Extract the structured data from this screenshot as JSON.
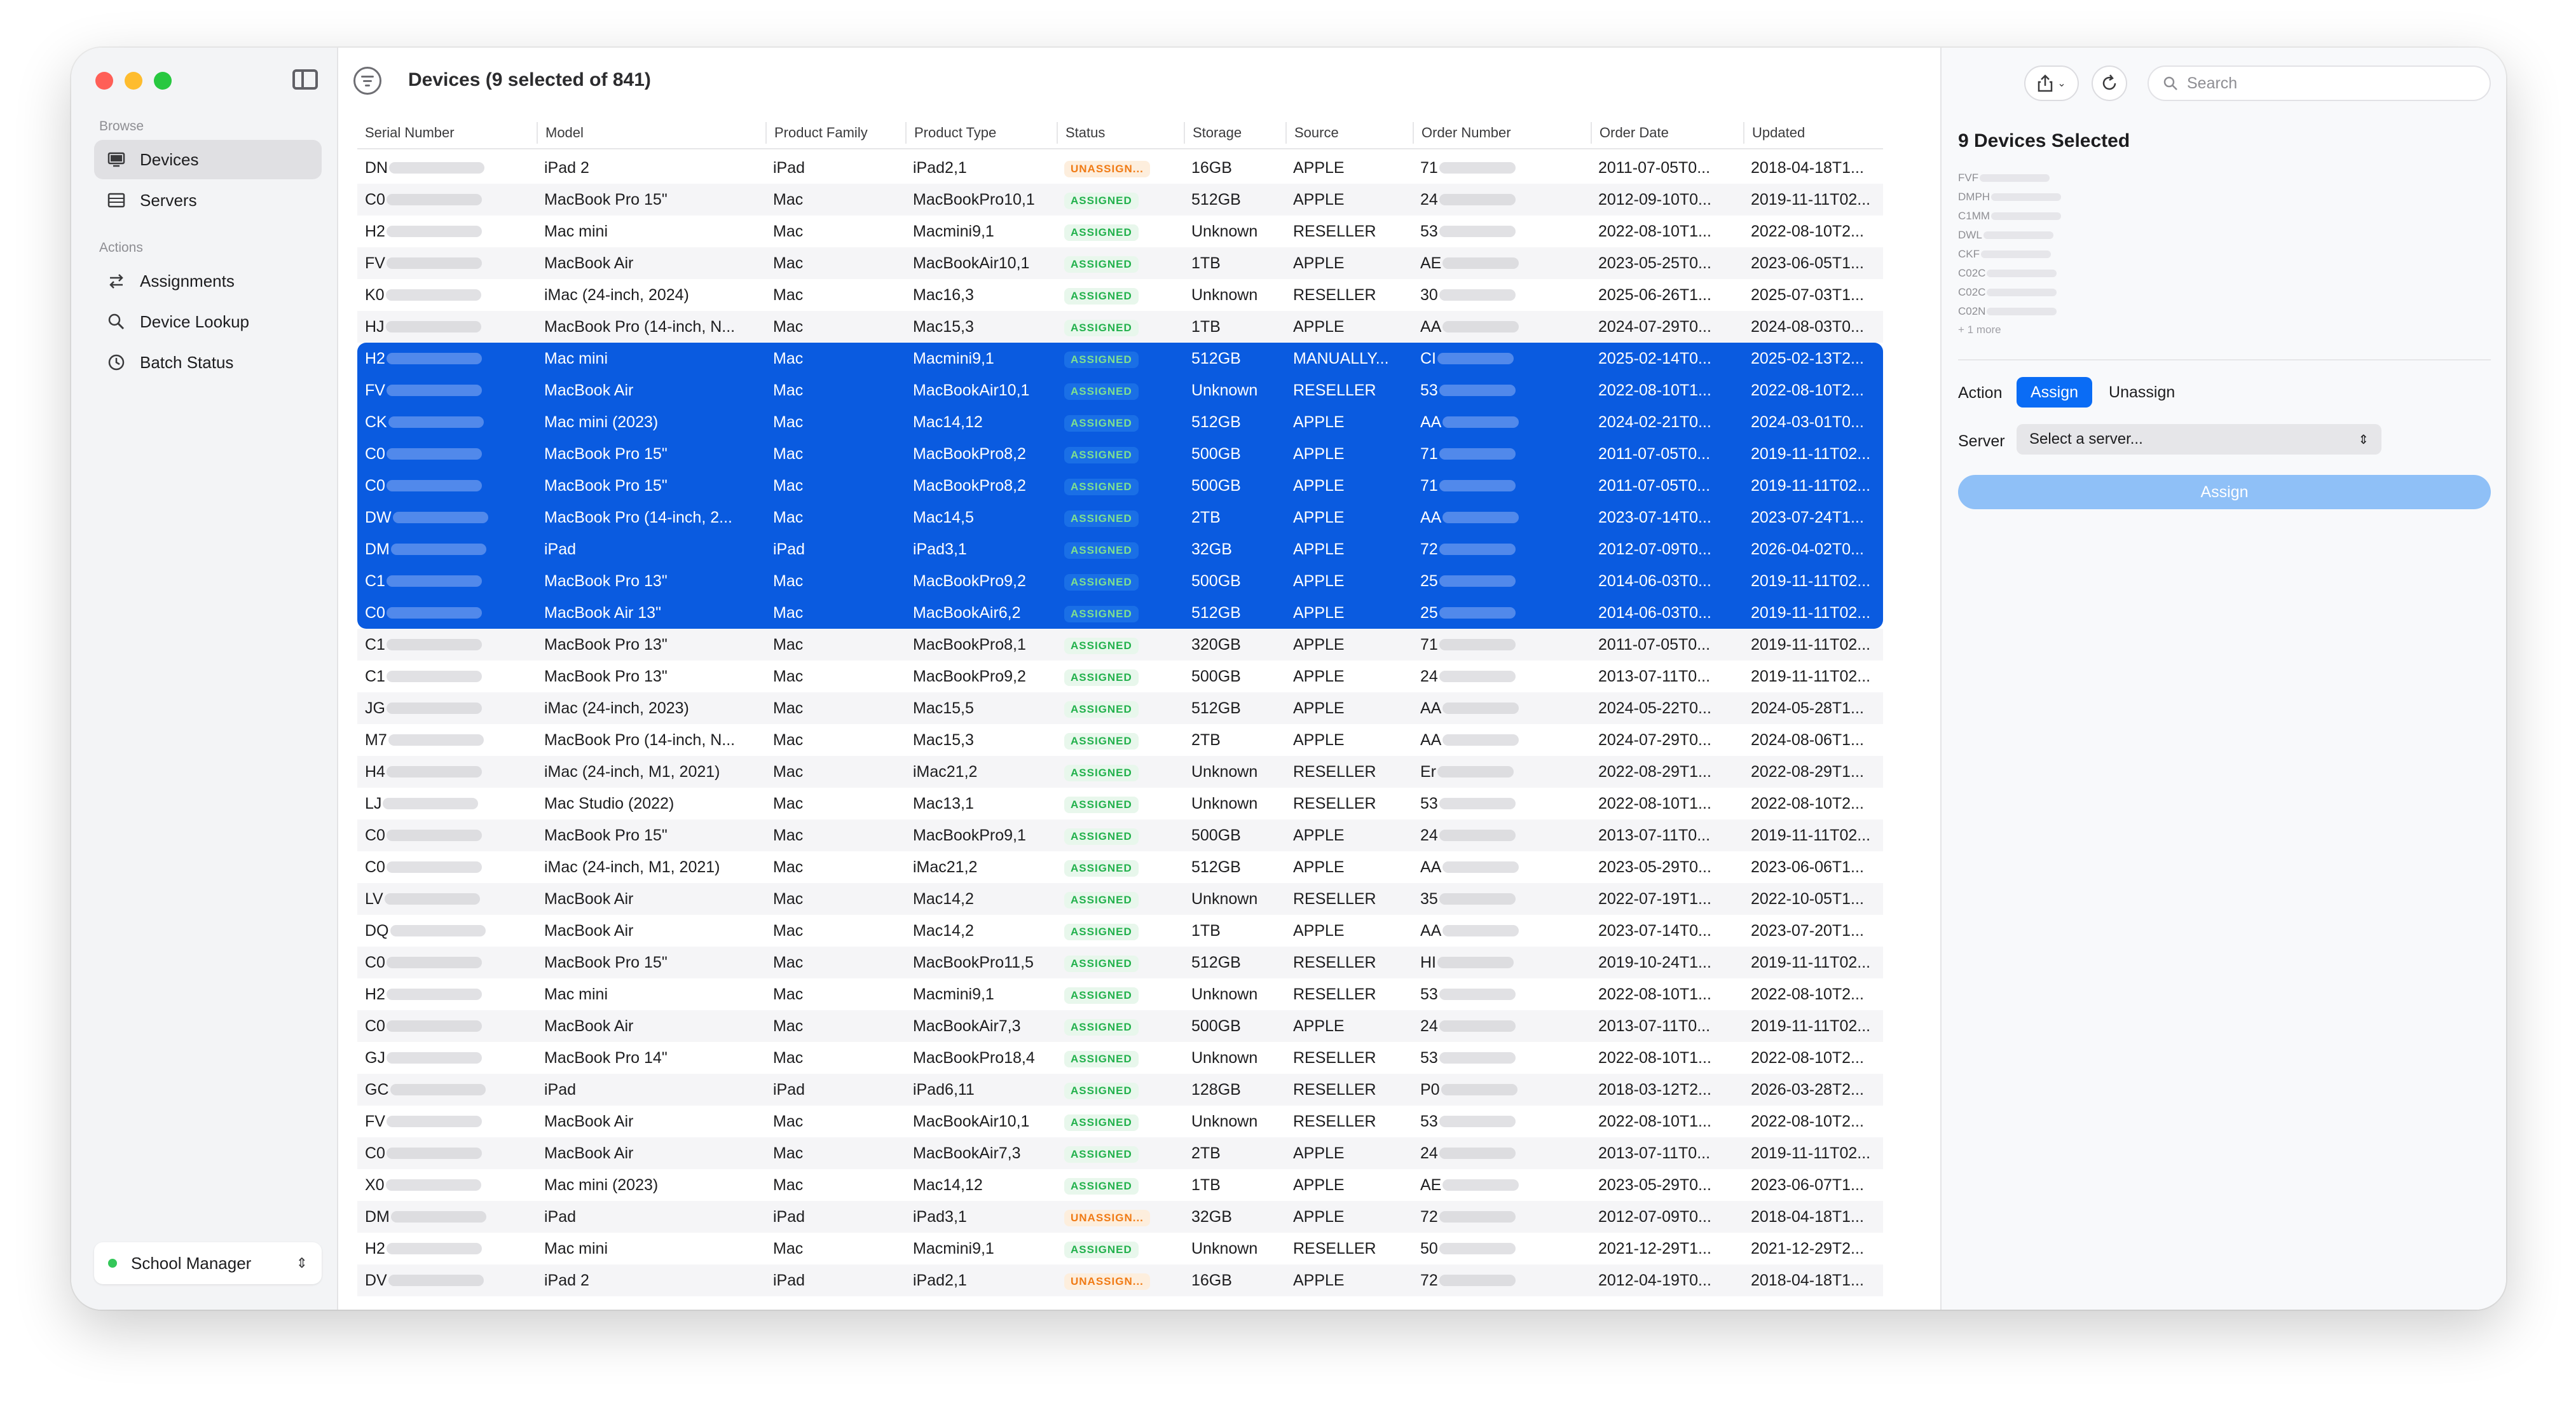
{
  "window": {
    "title": "Devices (9 selected of 841)"
  },
  "sidebar": {
    "browse_label": "Browse",
    "actions_label": "Actions",
    "browse_items": [
      {
        "label": "Devices",
        "icon": "desktop-icon",
        "active": true
      },
      {
        "label": "Servers",
        "icon": "server-icon",
        "active": false
      }
    ],
    "action_items": [
      {
        "label": "Assignments",
        "icon": "arrows-swap-icon"
      },
      {
        "label": "Device Lookup",
        "icon": "magnifier-icon"
      },
      {
        "label": "Batch Status",
        "icon": "clock-icon"
      }
    ],
    "manager": {
      "label": "School Manager",
      "status_color": "#34c759"
    }
  },
  "table": {
    "columns": [
      "Serial Number",
      "Model",
      "Product Family",
      "Product Type",
      "Status",
      "Storage",
      "Source",
      "Order Number",
      "Order Date",
      "Updated"
    ],
    "rows": [
      {
        "serial": "DN",
        "model": "iPad 2",
        "family": "iPad",
        "type": "iPad2,1",
        "status": "UNASSIGN...",
        "status_kind": "unassigned",
        "storage": "16GB",
        "source": "APPLE",
        "order": "71",
        "order_date": "2011-07-05T0...",
        "updated": "2018-04-18T1...",
        "selected": false
      },
      {
        "serial": "C0",
        "model": "MacBook Pro 15\"",
        "family": "Mac",
        "type": "MacBookPro10,1",
        "status": "ASSIGNED",
        "status_kind": "assigned",
        "storage": "512GB",
        "source": "APPLE",
        "order": "24",
        "order_date": "2012-09-10T0...",
        "updated": "2019-11-11T02...",
        "selected": false
      },
      {
        "serial": "H2",
        "model": "Mac mini",
        "family": "Mac",
        "type": "Macmini9,1",
        "status": "ASSIGNED",
        "status_kind": "assigned",
        "storage": "Unknown",
        "source": "RESELLER",
        "order": "53",
        "order_date": "2022-08-10T1...",
        "updated": "2022-08-10T2...",
        "selected": false
      },
      {
        "serial": "FV",
        "model": "MacBook Air",
        "family": "Mac",
        "type": "MacBookAir10,1",
        "status": "ASSIGNED",
        "status_kind": "assigned",
        "storage": "1TB",
        "source": "APPLE",
        "order": "AE",
        "order_date": "2023-05-25T0...",
        "updated": "2023-06-05T1...",
        "selected": false
      },
      {
        "serial": "K0",
        "model": "iMac (24-inch, 2024)",
        "family": "Mac",
        "type": "Mac16,3",
        "status": "ASSIGNED",
        "status_kind": "assigned",
        "storage": "Unknown",
        "source": "RESELLER",
        "order": "30",
        "order_date": "2025-06-26T1...",
        "updated": "2025-07-03T1...",
        "selected": false
      },
      {
        "serial": "HJ",
        "model": "MacBook Pro (14-inch, N...",
        "family": "Mac",
        "type": "Mac15,3",
        "status": "ASSIGNED",
        "status_kind": "assigned",
        "storage": "1TB",
        "source": "APPLE",
        "order": "AA",
        "order_date": "2024-07-29T0...",
        "updated": "2024-08-03T0...",
        "selected": false
      },
      {
        "serial": "H2",
        "model": "Mac mini",
        "family": "Mac",
        "type": "Macmini9,1",
        "status": "ASSIGNED",
        "status_kind": "assigned",
        "storage": "512GB",
        "source": "MANUALLY...",
        "order": "CI",
        "order_date": "2025-02-14T0...",
        "updated": "2025-02-13T2...",
        "selected": true
      },
      {
        "serial": "FV",
        "model": "MacBook Air",
        "family": "Mac",
        "type": "MacBookAir10,1",
        "status": "ASSIGNED",
        "status_kind": "assigned",
        "storage": "Unknown",
        "source": "RESELLER",
        "order": "53",
        "order_date": "2022-08-10T1...",
        "updated": "2022-08-10T2...",
        "selected": true
      },
      {
        "serial": "CK",
        "model": "Mac mini (2023)",
        "family": "Mac",
        "type": "Mac14,12",
        "status": "ASSIGNED",
        "status_kind": "assigned",
        "storage": "512GB",
        "source": "APPLE",
        "order": "AA",
        "order_date": "2024-02-21T0...",
        "updated": "2024-03-01T0...",
        "selected": true
      },
      {
        "serial": "C0",
        "model": "MacBook Pro 15\"",
        "family": "Mac",
        "type": "MacBookPro8,2",
        "status": "ASSIGNED",
        "status_kind": "assigned",
        "storage": "500GB",
        "source": "APPLE",
        "order": "71",
        "order_date": "2011-07-05T0...",
        "updated": "2019-11-11T02...",
        "selected": true
      },
      {
        "serial": "C0",
        "model": "MacBook Pro 15\"",
        "family": "Mac",
        "type": "MacBookPro8,2",
        "status": "ASSIGNED",
        "status_kind": "assigned",
        "storage": "500GB",
        "source": "APPLE",
        "order": "71",
        "order_date": "2011-07-05T0...",
        "updated": "2019-11-11T02...",
        "selected": true
      },
      {
        "serial": "DW",
        "model": "MacBook Pro (14-inch, 2...",
        "family": "Mac",
        "type": "Mac14,5",
        "status": "ASSIGNED",
        "status_kind": "assigned",
        "storage": "2TB",
        "source": "APPLE",
        "order": "AA",
        "order_date": "2023-07-14T0...",
        "updated": "2023-07-24T1...",
        "selected": true
      },
      {
        "serial": "DM",
        "model": "iPad",
        "family": "iPad",
        "type": "iPad3,1",
        "status": "ASSIGNED",
        "status_kind": "assigned",
        "storage": "32GB",
        "source": "APPLE",
        "order": "72",
        "order_date": "2012-07-09T0...",
        "updated": "2026-04-02T0...",
        "selected": true
      },
      {
        "serial": "C1",
        "model": "MacBook Pro 13\"",
        "family": "Mac",
        "type": "MacBookPro9,2",
        "status": "ASSIGNED",
        "status_kind": "assigned",
        "storage": "500GB",
        "source": "APPLE",
        "order": "25",
        "order_date": "2014-06-03T0...",
        "updated": "2019-11-11T02...",
        "selected": true
      },
      {
        "serial": "C0",
        "model": "MacBook Air 13\"",
        "family": "Mac",
        "type": "MacBookAir6,2",
        "status": "ASSIGNED",
        "status_kind": "assigned",
        "storage": "512GB",
        "source": "APPLE",
        "order": "25",
        "order_date": "2014-06-03T0...",
        "updated": "2019-11-11T02...",
        "selected": true
      },
      {
        "serial": "C1",
        "model": "MacBook Pro 13\"",
        "family": "Mac",
        "type": "MacBookPro8,1",
        "status": "ASSIGNED",
        "status_kind": "assigned",
        "storage": "320GB",
        "source": "APPLE",
        "order": "71",
        "order_date": "2011-07-05T0...",
        "updated": "2019-11-11T02...",
        "selected": false
      },
      {
        "serial": "C1",
        "model": "MacBook Pro 13\"",
        "family": "Mac",
        "type": "MacBookPro9,2",
        "status": "ASSIGNED",
        "status_kind": "assigned",
        "storage": "500GB",
        "source": "APPLE",
        "order": "24",
        "order_date": "2013-07-11T0...",
        "updated": "2019-11-11T02...",
        "selected": false
      },
      {
        "serial": "JG",
        "model": "iMac (24-inch, 2023)",
        "family": "Mac",
        "type": "Mac15,5",
        "status": "ASSIGNED",
        "status_kind": "assigned",
        "storage": "512GB",
        "source": "APPLE",
        "order": "AA",
        "order_date": "2024-05-22T0...",
        "updated": "2024-05-28T1...",
        "selected": false
      },
      {
        "serial": "M7",
        "model": "MacBook Pro (14-inch, N...",
        "family": "Mac",
        "type": "Mac15,3",
        "status": "ASSIGNED",
        "status_kind": "assigned",
        "storage": "2TB",
        "source": "APPLE",
        "order": "AA",
        "order_date": "2024-07-29T0...",
        "updated": "2024-08-06T1...",
        "selected": false
      },
      {
        "serial": "H4",
        "model": "iMac (24-inch, M1, 2021)",
        "family": "Mac",
        "type": "iMac21,2",
        "status": "ASSIGNED",
        "status_kind": "assigned",
        "storage": "Unknown",
        "source": "RESELLER",
        "order": "Er",
        "order_date": "2022-08-29T1...",
        "updated": "2022-08-29T1...",
        "selected": false
      },
      {
        "serial": "LJ",
        "model": "Mac Studio (2022)",
        "family": "Mac",
        "type": "Mac13,1",
        "status": "ASSIGNED",
        "status_kind": "assigned",
        "storage": "Unknown",
        "source": "RESELLER",
        "order": "53",
        "order_date": "2022-08-10T1...",
        "updated": "2022-08-10T2...",
        "selected": false
      },
      {
        "serial": "C0",
        "model": "MacBook Pro 15\"",
        "family": "Mac",
        "type": "MacBookPro9,1",
        "status": "ASSIGNED",
        "status_kind": "assigned",
        "storage": "500GB",
        "source": "APPLE",
        "order": "24",
        "order_date": "2013-07-11T0...",
        "updated": "2019-11-11T02...",
        "selected": false
      },
      {
        "serial": "C0",
        "model": "iMac (24-inch, M1, 2021)",
        "family": "Mac",
        "type": "iMac21,2",
        "status": "ASSIGNED",
        "status_kind": "assigned",
        "storage": "512GB",
        "source": "APPLE",
        "order": "AA",
        "order_date": "2023-05-29T0...",
        "updated": "2023-06-06T1...",
        "selected": false
      },
      {
        "serial": "LV",
        "model": "MacBook Air",
        "family": "Mac",
        "type": "Mac14,2",
        "status": "ASSIGNED",
        "status_kind": "assigned",
        "storage": "Unknown",
        "source": "RESELLER",
        "order": "35",
        "order_date": "2022-07-19T1...",
        "updated": "2022-10-05T1...",
        "selected": false
      },
      {
        "serial": "DQ",
        "model": "MacBook Air",
        "family": "Mac",
        "type": "Mac14,2",
        "status": "ASSIGNED",
        "status_kind": "assigned",
        "storage": "1TB",
        "source": "APPLE",
        "order": "AA",
        "order_date": "2023-07-14T0...",
        "updated": "2023-07-20T1...",
        "selected": false
      },
      {
        "serial": "C0",
        "model": "MacBook Pro 15\"",
        "family": "Mac",
        "type": "MacBookPro11,5",
        "status": "ASSIGNED",
        "status_kind": "assigned",
        "storage": "512GB",
        "source": "RESELLER",
        "order": "HI",
        "order_date": "2019-10-24T1...",
        "updated": "2019-11-11T02...",
        "selected": false
      },
      {
        "serial": "H2",
        "model": "Mac mini",
        "family": "Mac",
        "type": "Macmini9,1",
        "status": "ASSIGNED",
        "status_kind": "assigned",
        "storage": "Unknown",
        "source": "RESELLER",
        "order": "53",
        "order_date": "2022-08-10T1...",
        "updated": "2022-08-10T2...",
        "selected": false
      },
      {
        "serial": "C0",
        "model": "MacBook Air",
        "family": "Mac",
        "type": "MacBookAir7,3",
        "status": "ASSIGNED",
        "status_kind": "assigned",
        "storage": "500GB",
        "source": "APPLE",
        "order": "24",
        "order_date": "2013-07-11T0...",
        "updated": "2019-11-11T02...",
        "selected": false
      },
      {
        "serial": "GJ",
        "model": "MacBook Pro 14\"",
        "family": "Mac",
        "type": "MacBookPro18,4",
        "status": "ASSIGNED",
        "status_kind": "assigned",
        "storage": "Unknown",
        "source": "RESELLER",
        "order": "53",
        "order_date": "2022-08-10T1...",
        "updated": "2022-08-10T2...",
        "selected": false
      },
      {
        "serial": "GC",
        "model": "iPad",
        "family": "iPad",
        "type": "iPad6,11",
        "status": "ASSIGNED",
        "status_kind": "assigned",
        "storage": "128GB",
        "source": "RESELLER",
        "order": "P0",
        "order_date": "2018-03-12T2...",
        "updated": "2026-03-28T2...",
        "selected": false
      },
      {
        "serial": "FV",
        "model": "MacBook Air",
        "family": "Mac",
        "type": "MacBookAir10,1",
        "status": "ASSIGNED",
        "status_kind": "assigned",
        "storage": "Unknown",
        "source": "RESELLER",
        "order": "53",
        "order_date": "2022-08-10T1...",
        "updated": "2022-08-10T2...",
        "selected": false
      },
      {
        "serial": "C0",
        "model": "MacBook Air",
        "family": "Mac",
        "type": "MacBookAir7,3",
        "status": "ASSIGNED",
        "status_kind": "assigned",
        "storage": "2TB",
        "source": "APPLE",
        "order": "24",
        "order_date": "2013-07-11T0...",
        "updated": "2019-11-11T02...",
        "selected": false
      },
      {
        "serial": "X0",
        "model": "Mac mini (2023)",
        "family": "Mac",
        "type": "Mac14,12",
        "status": "ASSIGNED",
        "status_kind": "assigned",
        "storage": "1TB",
        "source": "APPLE",
        "order": "AE",
        "order_date": "2023-05-29T0...",
        "updated": "2023-06-07T1...",
        "selected": false
      },
      {
        "serial": "DM",
        "model": "iPad",
        "family": "iPad",
        "type": "iPad3,1",
        "status": "UNASSIGN...",
        "status_kind": "unassigned",
        "storage": "32GB",
        "source": "APPLE",
        "order": "72",
        "order_date": "2012-07-09T0...",
        "updated": "2018-04-18T1...",
        "selected": false
      },
      {
        "serial": "H2",
        "model": "Mac mini",
        "family": "Mac",
        "type": "Macmini9,1",
        "status": "ASSIGNED",
        "status_kind": "assigned",
        "storage": "Unknown",
        "source": "RESELLER",
        "order": "50",
        "order_date": "2021-12-29T1...",
        "updated": "2021-12-29T2...",
        "selected": false
      },
      {
        "serial": "DV",
        "model": "iPad 2",
        "family": "iPad",
        "type": "iPad2,1",
        "status": "UNASSIGN...",
        "status_kind": "unassigned",
        "storage": "16GB",
        "source": "APPLE",
        "order": "72",
        "order_date": "2012-04-19T0...",
        "updated": "2018-04-18T1...",
        "selected": false
      }
    ]
  },
  "inspector": {
    "search_placeholder": "Search",
    "title": "9 Devices Selected",
    "serials": [
      "FVF",
      "DMPH",
      "C1MM",
      "DWL",
      "CKF",
      "C02C",
      "C02C",
      "C02N"
    ],
    "more": "+ 1 more",
    "action_label": "Action",
    "action_options": [
      "Assign",
      "Unassign"
    ],
    "action_selected": "Assign",
    "server_label": "Server",
    "server_value": "Select a server...",
    "assign_button": "Assign",
    "accent_color": "#0a6cf5"
  }
}
